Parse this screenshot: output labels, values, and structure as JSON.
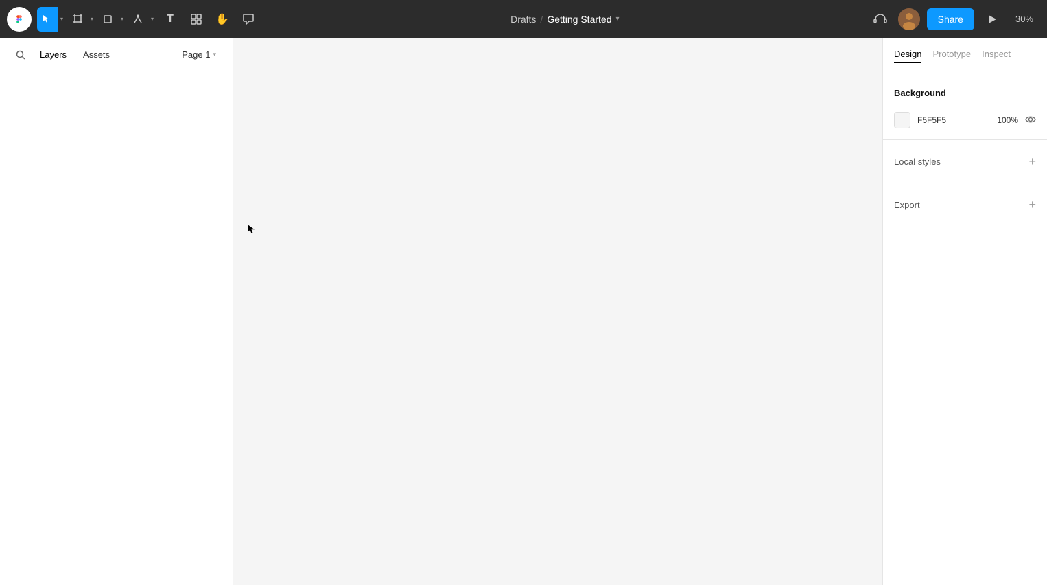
{
  "toolbar": {
    "tools": [
      {
        "id": "move",
        "label": "Move",
        "icon": "cursor",
        "active": true,
        "has_arrow": true
      },
      {
        "id": "frame",
        "label": "Frame",
        "icon": "frame",
        "active": false,
        "has_arrow": true
      },
      {
        "id": "rect",
        "label": "Rectangle",
        "icon": "rect",
        "active": false,
        "has_arrow": true
      },
      {
        "id": "pen",
        "label": "Pen",
        "icon": "pen",
        "active": false,
        "has_arrow": true
      },
      {
        "id": "text",
        "label": "Text",
        "icon": "text",
        "active": false
      },
      {
        "id": "components",
        "label": "Components",
        "icon": "components",
        "active": false
      },
      {
        "id": "hand",
        "label": "Hand",
        "icon": "hand",
        "active": false
      },
      {
        "id": "comment",
        "label": "Comment",
        "icon": "comment",
        "active": false
      }
    ],
    "project_name": "Getting Started",
    "breadcrumb_prefix": "Drafts",
    "breadcrumb_separator": "/",
    "share_label": "Share",
    "zoom_level": "30%"
  },
  "left_panel": {
    "tabs": [
      {
        "id": "layers",
        "label": "Layers",
        "active": true
      },
      {
        "id": "assets",
        "label": "Assets",
        "active": false
      }
    ],
    "page_selector": {
      "label": "Page 1",
      "has_dropdown": true
    }
  },
  "canvas": {
    "background_color": "#f5f5f5"
  },
  "right_panel": {
    "tabs": [
      {
        "id": "design",
        "label": "Design",
        "active": true
      },
      {
        "id": "prototype",
        "label": "Prototype",
        "active": false
      },
      {
        "id": "inspect",
        "label": "Inspect",
        "active": false
      }
    ],
    "design": {
      "background_section": {
        "title": "Background",
        "color_hex": "F5F5F5",
        "opacity": "100%",
        "show_eye": true
      },
      "local_styles_section": {
        "title": "Local styles",
        "add_label": "+"
      },
      "export_section": {
        "title": "Export",
        "add_label": "+"
      }
    }
  }
}
